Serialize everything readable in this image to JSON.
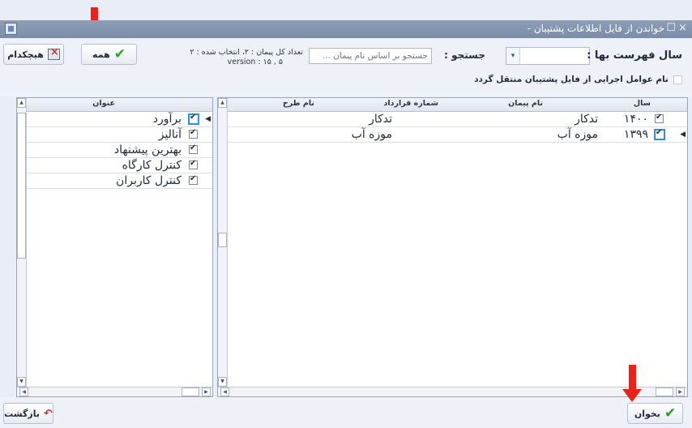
{
  "window": {
    "title": "خواندن از فایل اطلاعات پشتیبان -",
    "controls": [
      "×",
      "☐"
    ]
  },
  "toolbar": {
    "year_list_label": "سال فهرست بها :",
    "search_label": "جستجو :",
    "search_placeholder": "جستجو بر اساس نام پیمان ...",
    "count_text": "تعداد کل پیمان : ۲، انتخاب شده : ۲",
    "version_text": "version : ۱۵ , ۵",
    "all_button": "همه",
    "none_button": "هیچکدام",
    "transfer_checkbox_label": "نام عوامل اجرایی از فایل پشتیبان منتقل گردد"
  },
  "contracts_grid": {
    "headers": [
      "سال",
      "نام پیمان",
      "شماره قرارداد",
      "نام طرح"
    ],
    "rows": [
      {
        "year": "۱۴۰۰",
        "contract": "تدکار",
        "number": "",
        "project": "تدکار",
        "checked": true
      },
      {
        "year": "۱۳۹۹",
        "contract": "موزه آب",
        "number": "",
        "project": "موزه آب",
        "checked": true
      }
    ]
  },
  "items_grid": {
    "header": "عنوان",
    "rows": [
      {
        "title": "برآورد",
        "checked": true
      },
      {
        "title": "آنالیز",
        "checked": true
      },
      {
        "title": "بهترین پیشنهاد",
        "checked": true
      },
      {
        "title": "کنترل کارگاه",
        "checked": true
      },
      {
        "title": "کنترل کاربران",
        "checked": true
      }
    ]
  },
  "footer": {
    "read_button": "بخوان",
    "back_button": "بازگشت"
  },
  "colors": {
    "accent_red": "#e8231d",
    "check_green": "#2e9e22",
    "title_bar": "#7a8da8"
  }
}
